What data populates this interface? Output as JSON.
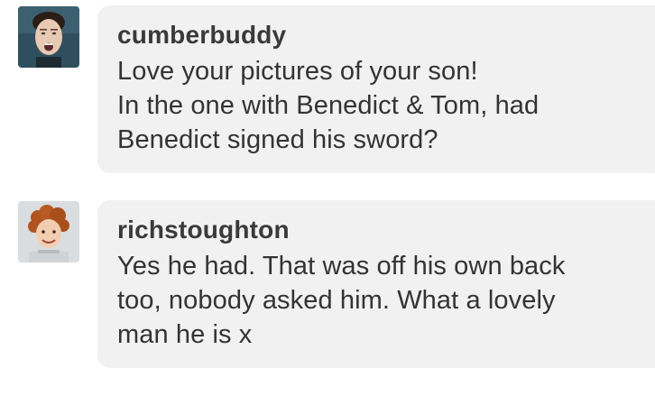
{
  "messages": [
    {
      "username": "cumberbuddy",
      "avatar_icon": "man-face-avatar-icon",
      "lines": [
        "Love your pictures of your son!",
        "In the one with Benedict & Tom, had",
        "Benedict signed his sword?"
      ]
    },
    {
      "username": "richstoughton",
      "avatar_icon": "curly-haired-child-avatar-icon",
      "lines": [
        "Yes he had.  That was off his own back",
        "too, nobody asked him.  What a lovely",
        "man he is x"
      ]
    }
  ],
  "colors": {
    "bubble_background": "#f1f1f1",
    "username": "#3a3a3a",
    "text": "#333333"
  }
}
